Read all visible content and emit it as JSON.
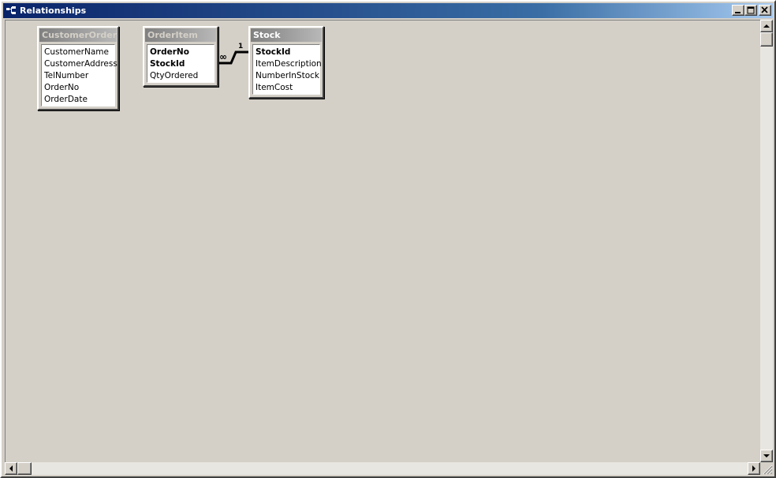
{
  "window": {
    "title": "Relationships",
    "icon": "relationships-window-icon",
    "controls": [
      "minimize-icon",
      "maximize-icon",
      "close-icon"
    ]
  },
  "tables": [
    {
      "name": "CustomerOrder",
      "active": false,
      "fields": [
        {
          "label": "CustomerName",
          "key": false
        },
        {
          "label": "CustomerAddress",
          "key": false
        },
        {
          "label": "TelNumber",
          "key": false
        },
        {
          "label": "OrderNo",
          "key": false
        },
        {
          "label": "OrderDate",
          "key": false
        }
      ]
    },
    {
      "name": "OrderItem",
      "active": false,
      "fields": [
        {
          "label": "OrderNo",
          "key": true
        },
        {
          "label": "StockId",
          "key": true
        },
        {
          "label": "QtyOrdered",
          "key": false
        }
      ]
    },
    {
      "name": "Stock",
      "active": true,
      "fields": [
        {
          "label": "StockId",
          "key": true
        },
        {
          "label": "ItemDescription",
          "key": false
        },
        {
          "label": "NumberInStock",
          "key": false
        },
        {
          "label": "ItemCost",
          "key": false
        }
      ]
    }
  ],
  "relationships": [
    {
      "from": "OrderItem.StockId",
      "to": "Stock.StockId",
      "many_symbol": "∞",
      "one_symbol": "1"
    }
  ],
  "colors": {
    "titlebar_start": "#0a246a",
    "titlebar_end": "#a6caf0",
    "workspace": "#d4d0c8",
    "table_header": "#808080"
  }
}
